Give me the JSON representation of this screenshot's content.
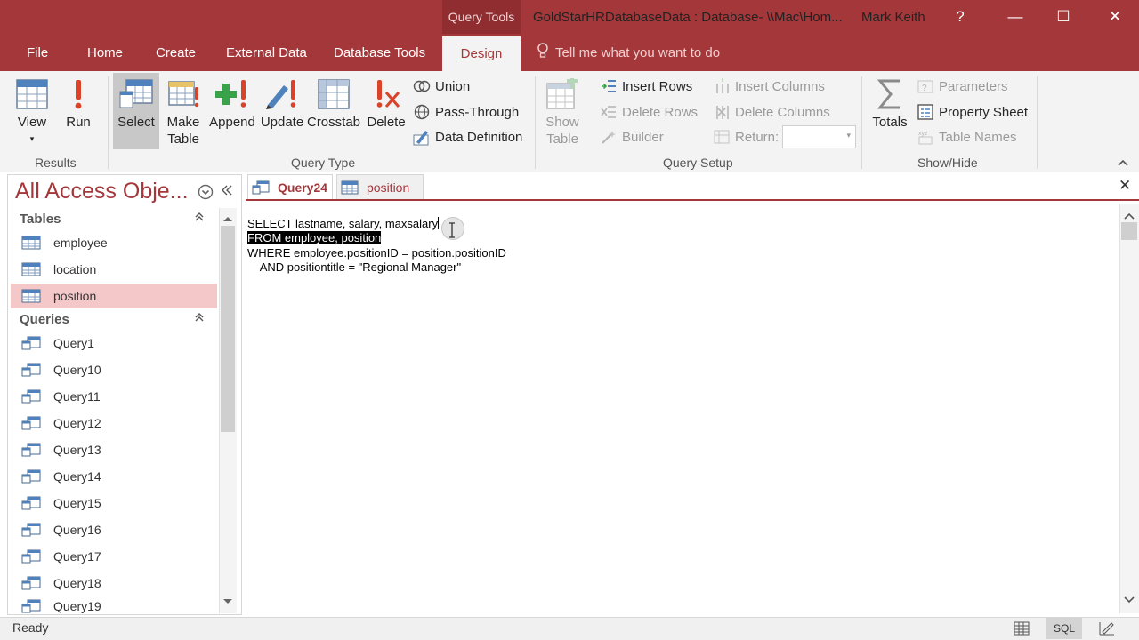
{
  "titlebar": {
    "context_tab": "Query Tools",
    "doc_title": "GoldStarHRDatabaseData : Database- \\\\Mac\\Hom...",
    "user": "Mark Keith",
    "help": "?",
    "minimize": "—",
    "maximize": "☐",
    "close": "✕"
  },
  "tabs": {
    "file": "File",
    "home": "Home",
    "create": "Create",
    "external": "External Data",
    "dbtools": "Database Tools",
    "design": "Design",
    "tellme": "Tell me what you want to do"
  },
  "ribbon": {
    "results": {
      "label": "Results",
      "view": "View",
      "run": "Run"
    },
    "query_type": {
      "label": "Query Type",
      "select": "Select",
      "make_table_1": "Make",
      "make_table_2": "Table",
      "append": "Append",
      "update": "Update",
      "crosstab": "Crosstab",
      "delete": "Delete",
      "union": "Union",
      "pass_through": "Pass-Through",
      "data_definition": "Data Definition"
    },
    "query_setup": {
      "label": "Query Setup",
      "show_table_1": "Show",
      "show_table_2": "Table",
      "insert_rows": "Insert Rows",
      "delete_rows": "Delete Rows",
      "builder": "Builder",
      "insert_columns": "Insert Columns",
      "delete_columns": "Delete Columns",
      "return": "Return:"
    },
    "show_hide": {
      "label": "Show/Hide",
      "totals": "Totals",
      "parameters": "Parameters",
      "property_sheet": "Property Sheet",
      "table_names": "Table Names"
    }
  },
  "nav": {
    "title": "All Access Obje...",
    "tables_header": "Tables",
    "tables": [
      {
        "label": "employee"
      },
      {
        "label": "location"
      },
      {
        "label": "position"
      }
    ],
    "queries_header": "Queries",
    "queries": [
      {
        "label": "Query1"
      },
      {
        "label": "Query10"
      },
      {
        "label": "Query11"
      },
      {
        "label": "Query12"
      },
      {
        "label": "Query13"
      },
      {
        "label": "Query14"
      },
      {
        "label": "Query15"
      },
      {
        "label": "Query16"
      },
      {
        "label": "Query17"
      },
      {
        "label": "Query18"
      },
      {
        "label": "Query19"
      }
    ]
  },
  "doc": {
    "tabs": [
      {
        "label": "Query24"
      },
      {
        "label": "position"
      }
    ],
    "sql_lines": [
      "SELECT lastname, salary, maxsalary",
      "FROM employee, position",
      "WHERE employee.positionID = position.positionID",
      "    AND positiontitle = \"Regional Manager\""
    ]
  },
  "status": {
    "text": "Ready",
    "view_sql": "SQL"
  },
  "colors": {
    "brand": "#a4373a",
    "ribbon": "#f3f3f3",
    "selected_nav": "#f4c7c8"
  }
}
